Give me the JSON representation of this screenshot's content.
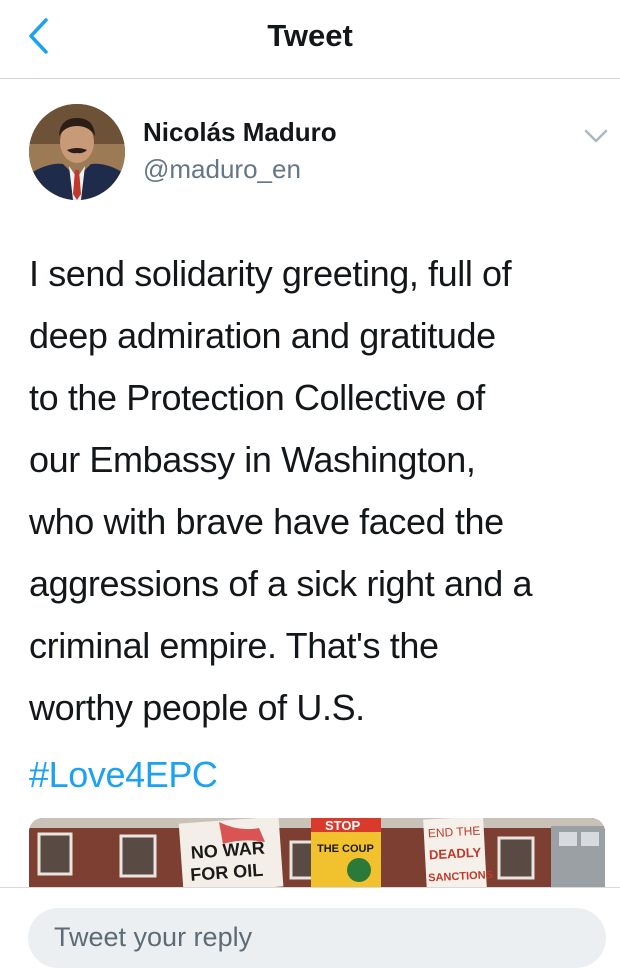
{
  "navbar": {
    "title": "Tweet"
  },
  "author": {
    "name": "Nicolás Maduro",
    "handle": "@maduro_en"
  },
  "tweet": {
    "lines": [
      "I send solidarity greeting, full of",
      "deep admiration and gratitude",
      "to the Protection Collective of",
      "our Embassy in Washington,",
      "who with brave have faced the",
      "aggressions of a sick right and a",
      "criminal empire. That's the",
      "worthy people of U.S."
    ],
    "hashtag": "#Love4EPC"
  },
  "media": {
    "signs": [
      "NO WAR",
      "FOR OIL",
      "STOP",
      "THE COUP",
      "END THE",
      "DEADLY",
      "SANCTIONS"
    ]
  },
  "reply": {
    "placeholder": "Tweet your reply"
  },
  "colors": {
    "accent": "#1da1f2",
    "text": "#14171a",
    "secondary_text": "#657786"
  }
}
